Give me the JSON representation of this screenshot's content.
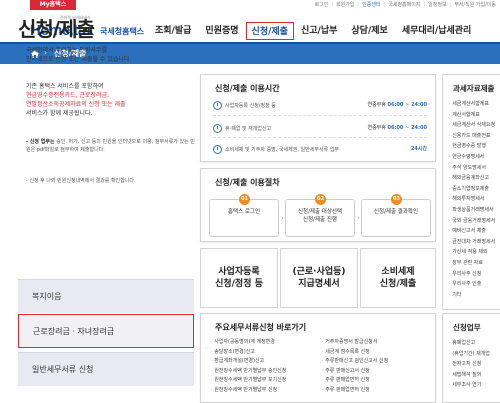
{
  "topbar": {
    "my_hometax": "My홈택스",
    "links": [
      "로그인",
      "회원가입",
      "인증센터",
      "국세청홈페이지",
      "일정정보",
      "부서/직원 가입/이동"
    ]
  },
  "logo": {
    "tagline": "전자적 납세서비스",
    "name_part1": "Home",
    "name_part2": "tax",
    "korean": "국세청홈택스"
  },
  "gnb": {
    "items": [
      "조회/발급",
      "민원증명",
      "신청/제출",
      "신고/납부",
      "상담/제보",
      "세무대리/납세관리"
    ],
    "active_index": 2
  },
  "breadcrumb": {
    "label": "신청/제출"
  },
  "colors": {
    "brand_blue": "#2a70bd",
    "highlight_red": "#e0282e",
    "step_orange": "#f08c22"
  },
  "left": {
    "title": "신청/제출",
    "intro_line1": "국세청에서 주관하는 민원사무를",
    "intro_line2": "인터넷으로 신청 또는 제출할 수 있습니다.",
    "intro2_line1": "기존 홈택스 서비스를 포함하여",
    "intro2_red1": "현금영수증전용카드, 근로장려금,",
    "intro2_red2": "연말정산소득공제자료의 신청 또는 제출",
    "intro2_line4": "서비스가 함께 제공됩니다.",
    "note1_bold": "- 신청 업무는",
    "note1_rest": "승인, 허가, 신고 등의 민원을 인터넷으로 이용, 첨부서류가 있는 민원은 pdf파일로 첨부하여 제출합니다.",
    "note2": "- 신청 후 나의 민원신청내역에서 결과를 확인합니다.",
    "nav": [
      "복지이음",
      "근로장려금 · 자녀장려금",
      "일반세무서류 신청"
    ]
  },
  "hours": {
    "title": "신청/제출 이용시간",
    "rows": [
      {
        "label": "사업자등록 신청/정정 등",
        "time_prefix": "연중무휴",
        "time": "06:00 ~ 24:00"
      },
      {
        "label": "휴·폐업 및 재개업신고",
        "time_prefix": "연중무휴",
        "time": "06:00 ~ 24:00"
      },
      {
        "label": "소비세제 및 기주자 증명, 국세체권, 일반세무서류 업무",
        "time_prefix": "",
        "time": "24시간"
      }
    ]
  },
  "procedure": {
    "title": "신청/제출 이용절차",
    "steps": [
      {
        "num": "01",
        "text1": "홈택스 로그인",
        "text2": ""
      },
      {
        "num": "02",
        "text1": "신청/제출 대상선택",
        "text2": "신청/제출 진행"
      },
      {
        "num": "03",
        "text1": "신청/제출 결과확인",
        "text2": ""
      }
    ]
  },
  "big_buttons": [
    {
      "line1": "사업자등록",
      "line2": "신청/정정 등"
    },
    {
      "line1": "(근로·사업등)",
      "line2": "지급명세서"
    },
    {
      "line1": "소비세제",
      "line2": "신청/제출"
    }
  ],
  "docs": {
    "title": "주요세무서류신청 바로가기",
    "col1": [
      "사업자(공동명의)계 계정변경",
      "송달장소(변경)신고",
      "환급계좌개설(변경)신고",
      "원천징수세액 반기별납부 승인신청",
      "원천징수세액 반기별납부 포기신청",
      "원천징수세액 반기별납부 신청"
    ],
    "col2": [
      "거주자증명서 발급신청서",
      "세금계 점수목록 신청",
      "주류판매신고 검인신고서 신청",
      "주류 판매신고서 신청",
      "주류 판매업면허 신청",
      "주류 판매업면허 신청"
    ]
  },
  "right1": {
    "title": "과세자료제출",
    "items": [
      "세금계산서합계표",
      "계산서합계표",
      "세금계산서 삭제요청",
      "신용카드 매출전표",
      "현금영수증 발행",
      "연금수령명세서",
      "주식 양도명세서",
      "해외금융계좌신고",
      "중소기업정보제출",
      "해외투자명세서",
      "파생상품거래명세서",
      "국외 금융거래명세서",
      "예비신고서 제출",
      "금전대차 거래명세서",
      "가산세 적용 제외",
      "장부 관련 자료",
      "우리사주 신청",
      "우리사주 인출",
      "기타"
    ]
  },
  "right2": {
    "title": "신청업무",
    "items": [
      "휴폐업신고",
      "(휴업기간) 재개업",
      "전자고지 신청",
      "세법해석 질의",
      "세무조사 연기"
    ]
  }
}
